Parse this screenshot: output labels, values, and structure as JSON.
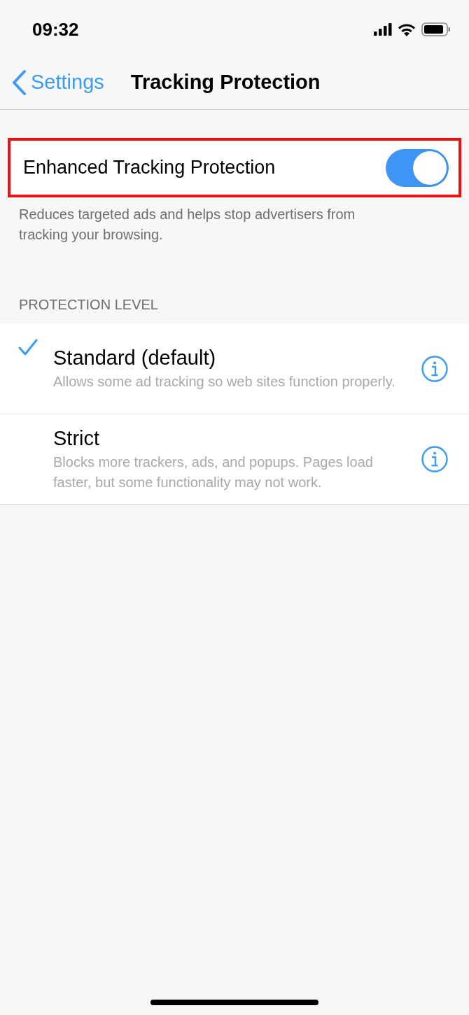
{
  "status_bar": {
    "time": "09:32"
  },
  "nav": {
    "back_label": "Settings",
    "title": "Tracking Protection"
  },
  "toggle_row": {
    "label": "Enhanced Tracking Protection",
    "on": true,
    "highlighted": true
  },
  "toggle_description": "Reduces targeted ads and helps stop advertisers from tracking your browsing.",
  "section": {
    "header": "PROTECTION LEVEL",
    "options": [
      {
        "title": "Standard (default)",
        "subtitle": "Allows some ad tracking so web sites function properly.",
        "selected": true
      },
      {
        "title": "Strict",
        "subtitle": "Blocks more trackers, ads, and popups. Pages load faster, but some functionality may not work.",
        "selected": false
      }
    ]
  }
}
